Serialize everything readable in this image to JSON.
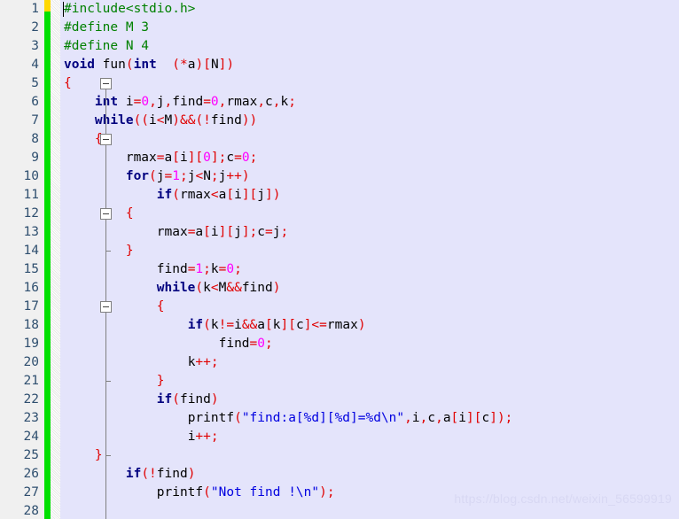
{
  "editor": {
    "language": "C",
    "background_color": "#e4e4fb",
    "gutter_color": "#f0f0f0",
    "line_number_color": "#2f4f6f",
    "change_bar_color": "#00e000",
    "saved_marker_color": "#ffd800",
    "caret": {
      "line": 1,
      "column": 1
    },
    "first_visible_line": 1,
    "last_visible_line": 28
  },
  "syntax_colors": {
    "preprocessor": "#008000",
    "keyword": "#00007f",
    "number": "#ff00ff",
    "punctuation": "#e00000",
    "string": "#0000e0",
    "identifier": "#000000"
  },
  "gutter": {
    "line_numbers": [
      "1",
      "2",
      "3",
      "4",
      "5",
      "6",
      "7",
      "8",
      "9",
      "10",
      "11",
      "12",
      "13",
      "14",
      "15",
      "16",
      "17",
      "18",
      "19",
      "20",
      "21",
      "22",
      "23",
      "24",
      "25",
      "26",
      "27",
      "28"
    ],
    "fold_boxes": [
      5,
      8,
      12,
      17
    ],
    "fold_ends": [
      14,
      21,
      25
    ]
  },
  "code": {
    "lines": [
      "#include<stdio.h>",
      "#define M 3",
      "#define N 4",
      "void fun(int  (*a)[N])",
      "{",
      "    int i=0,j,find=0,rmax,c,k;",
      "    while((i<M)&&(!find))",
      "    {",
      "        rmax=a[i][0];c=0;",
      "        for(j=1;j<N;j++)",
      "            if(rmax<a[i][j])",
      "        {",
      "            rmax=a[i][j];c=j;",
      "        }",
      "            find=1;k=0;",
      "            while(k<M&&find)",
      "            {",
      "                if(k!=i&&a[k][c]<=rmax)",
      "                    find=0;",
      "                k++;",
      "            }",
      "            if(find)",
      "                printf(\"find:a[%d][%d]=%d\\n\",i,c,a[i][c]);",
      "                i++;",
      "    }",
      "        if(!find)",
      "            printf(\"Not find !\\n\");",
      ""
    ]
  },
  "watermark": {
    "text": "https://blog.csdn.net/weixin_56599919",
    "color": "#d8d8f3"
  }
}
